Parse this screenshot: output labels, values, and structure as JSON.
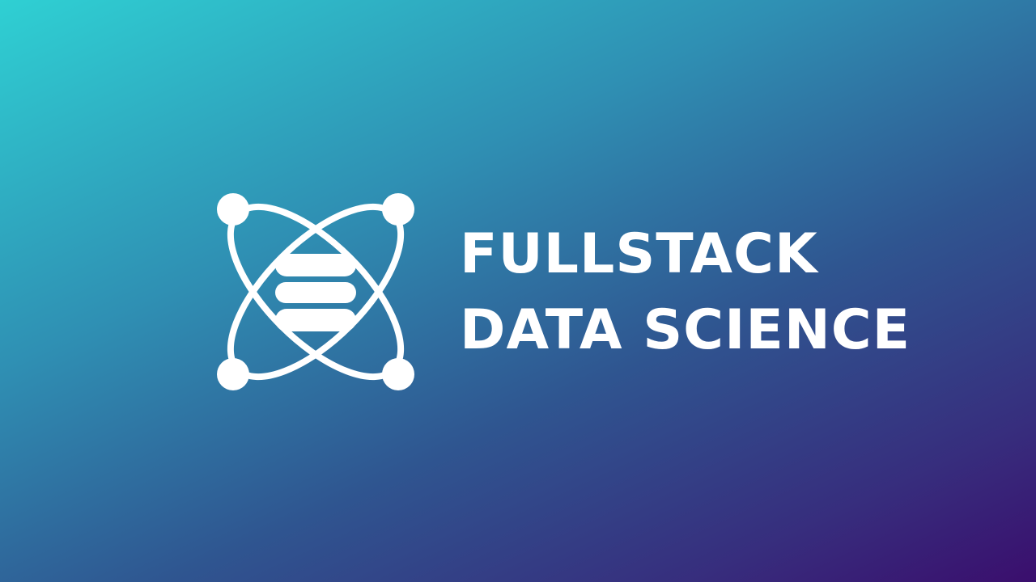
{
  "brand": {
    "name_line_1": "FULLSTACK",
    "name_line_2": "DATA SCIENCE"
  },
  "logo": {
    "icon": "atom-database-icon",
    "orbit_dots": 4
  },
  "colors": {
    "text": "#ffffff",
    "gradient_start": "#2fd0d3",
    "gradient_mid": "#2f5590",
    "gradient_end": "#3a0e6d"
  }
}
